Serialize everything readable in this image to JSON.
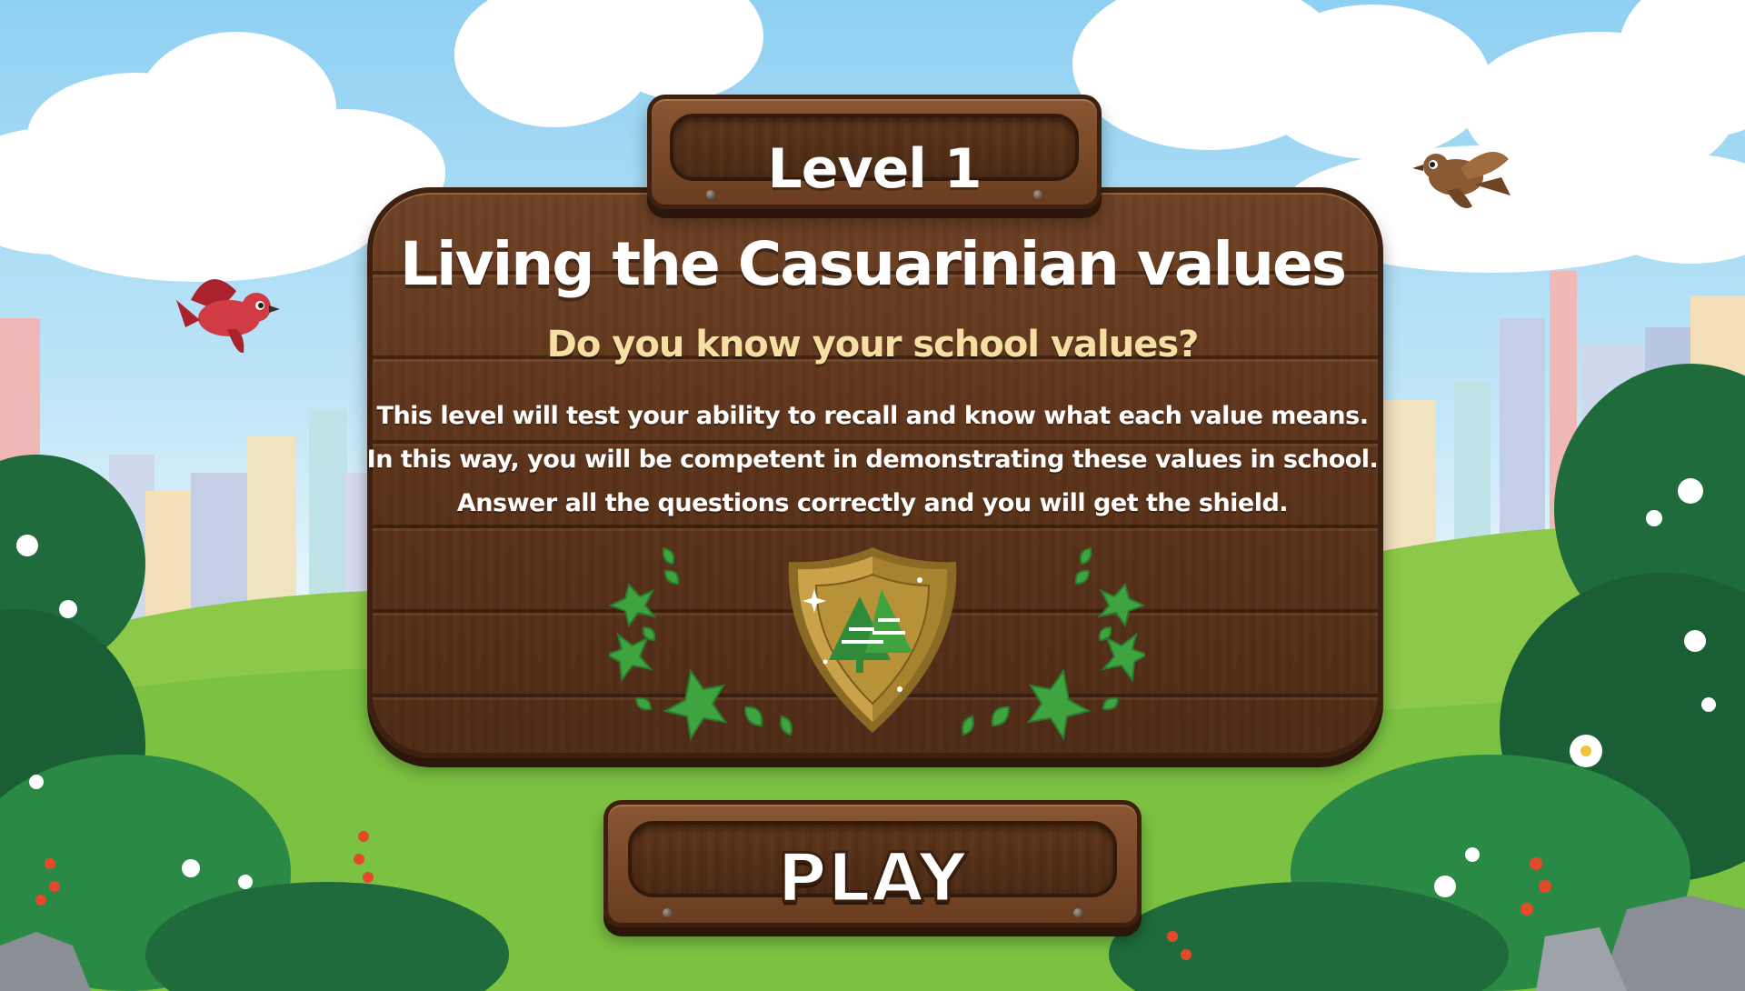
{
  "level_badge": {
    "label": "Level 1"
  },
  "card": {
    "title": "Living the Casuarinian values",
    "subtitle": "Do you know your school values?",
    "description_lines": [
      "This level will test your ability to recall and know what each value means.",
      "In this way, you will be competent in demonstrating these values in school.",
      "Answer all the questions correctly and you will get the shield."
    ]
  },
  "play_button": {
    "label": "PLAY"
  },
  "icons": {
    "reward": "shield-with-trees-icon",
    "decoration_left": "leaf-wreath-left-icon",
    "decoration_right": "leaf-wreath-right-icon"
  },
  "colors": {
    "wood": "#5b3219",
    "wood_dark": "#3d200f",
    "title_text": "#ffffff",
    "subtitle_text": "#f6dfa3",
    "shield_gold": "#c9a24a",
    "leaf_green": "#3fa33f",
    "grass": "#7cc242",
    "sky": "#8fd0f2"
  }
}
